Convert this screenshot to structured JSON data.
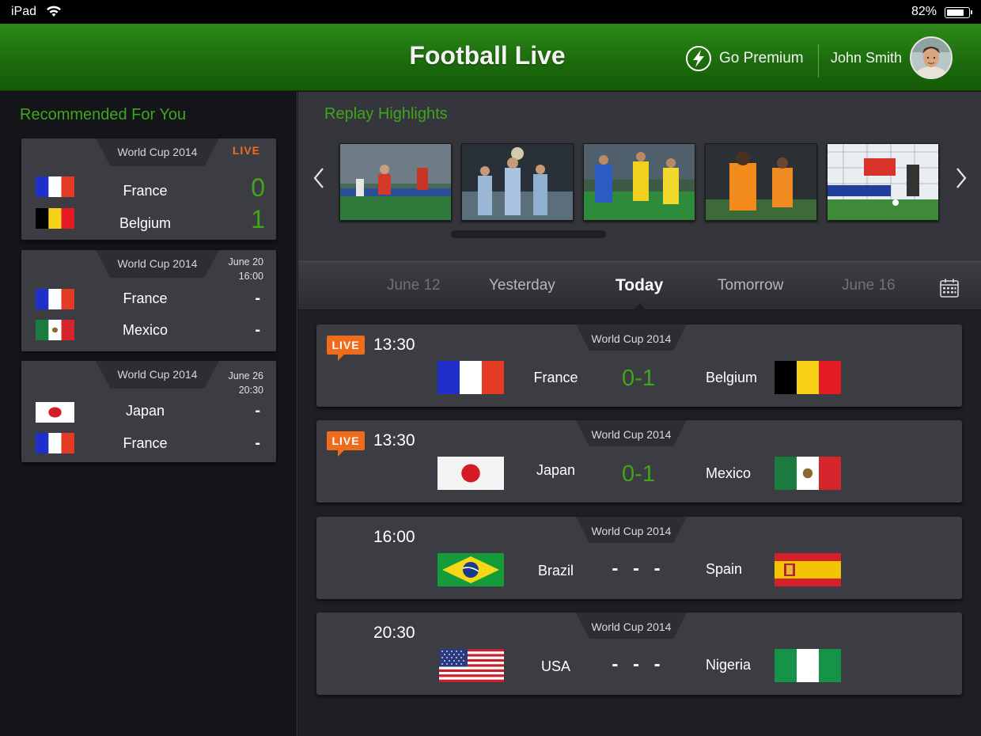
{
  "status_bar": {
    "device": "iPad",
    "battery_percent": "82%",
    "battery_level": 0.82
  },
  "header": {
    "title": "Football Live",
    "premium_label": "Go Premium",
    "user_name": "John Smith"
  },
  "sidebar": {
    "title": "Recommended For You",
    "cards": [
      {
        "competition": "World Cup 2014",
        "status": "LIVE",
        "date": "",
        "time": "",
        "home": {
          "name": "France",
          "flag": "france-flag",
          "score": "0"
        },
        "away": {
          "name": "Belgium",
          "flag": "belgium-flag",
          "score": "1"
        }
      },
      {
        "competition": "World Cup 2014",
        "status": "",
        "date": "June 20",
        "time": "16:00",
        "home": {
          "name": "France",
          "flag": "france-flag",
          "score": "-"
        },
        "away": {
          "name": "Mexico",
          "flag": "mexico-flag",
          "score": "-"
        }
      },
      {
        "competition": "World Cup 2014",
        "status": "",
        "date": "June 26",
        "time": "20:30",
        "home": {
          "name": "Japan",
          "flag": "japan-flag",
          "score": "-"
        },
        "away": {
          "name": "France",
          "flag": "france-flag",
          "score": "-"
        }
      }
    ]
  },
  "replay": {
    "title": "Replay Highlights",
    "thumbnails": [
      "highlight-1-thumbnail",
      "highlight-2-thumbnail",
      "highlight-3-thumbnail",
      "highlight-4-thumbnail",
      "highlight-5-thumbnail"
    ]
  },
  "date_tabs": [
    {
      "label": "June 12",
      "state": "far"
    },
    {
      "label": "Yesterday",
      "state": "near"
    },
    {
      "label": "Today",
      "state": "active"
    },
    {
      "label": "Tomorrow",
      "state": "near"
    },
    {
      "label": "June 16",
      "state": "far"
    }
  ],
  "matches": [
    {
      "live": true,
      "live_label": "LIVE",
      "time": "13:30",
      "competition": "World Cup 2014",
      "home": {
        "name": "France",
        "flag": "france-flag"
      },
      "away": {
        "name": "Belgium",
        "flag": "belgium-flag"
      },
      "score": "0-1"
    },
    {
      "live": true,
      "live_label": "LIVE",
      "time": "13:30",
      "competition": "World Cup 2014",
      "home": {
        "name": "Japan",
        "flag": "japan-flag"
      },
      "away": {
        "name": "Mexico",
        "flag": "mexico-flag"
      },
      "score": "0-1"
    },
    {
      "live": false,
      "live_label": "",
      "time": "16:00",
      "competition": "World Cup 2014",
      "home": {
        "name": "Brazil",
        "flag": "brazil-flag"
      },
      "away": {
        "name": "Spain",
        "flag": "spain-flag"
      },
      "score": "- - -"
    },
    {
      "live": false,
      "live_label": "",
      "time": "20:30",
      "competition": "World Cup 2014",
      "home": {
        "name": "USA",
        "flag": "usa-flag"
      },
      "away": {
        "name": "Nigeria",
        "flag": "nigeria-flag"
      },
      "score": "- - -"
    }
  ],
  "colors": {
    "brand_green": "#3fa61b",
    "live_orange": "#f06c1d",
    "header_green": "#1d6c0d"
  }
}
